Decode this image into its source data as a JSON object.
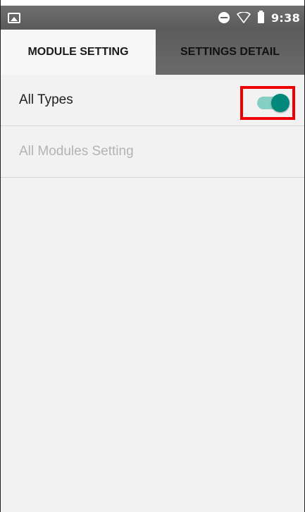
{
  "status_bar": {
    "time": "9:38",
    "icons": [
      "image-icon",
      "do-not-disturb-icon",
      "wifi-icon",
      "battery-icon"
    ]
  },
  "tabs": [
    {
      "label": "MODULE SETTING",
      "selected": true
    },
    {
      "label": "SETTINGS DETAIL",
      "selected": false
    }
  ],
  "rows": [
    {
      "label": "All Types",
      "switch_on": true
    },
    {
      "label": "All Modules Setting",
      "enabled": false
    }
  ],
  "colors": {
    "switch_thumb": "#00897b",
    "switch_track": "#86cfc4",
    "highlight": "#ee0000",
    "disabled_text": "#b3b3b3"
  }
}
